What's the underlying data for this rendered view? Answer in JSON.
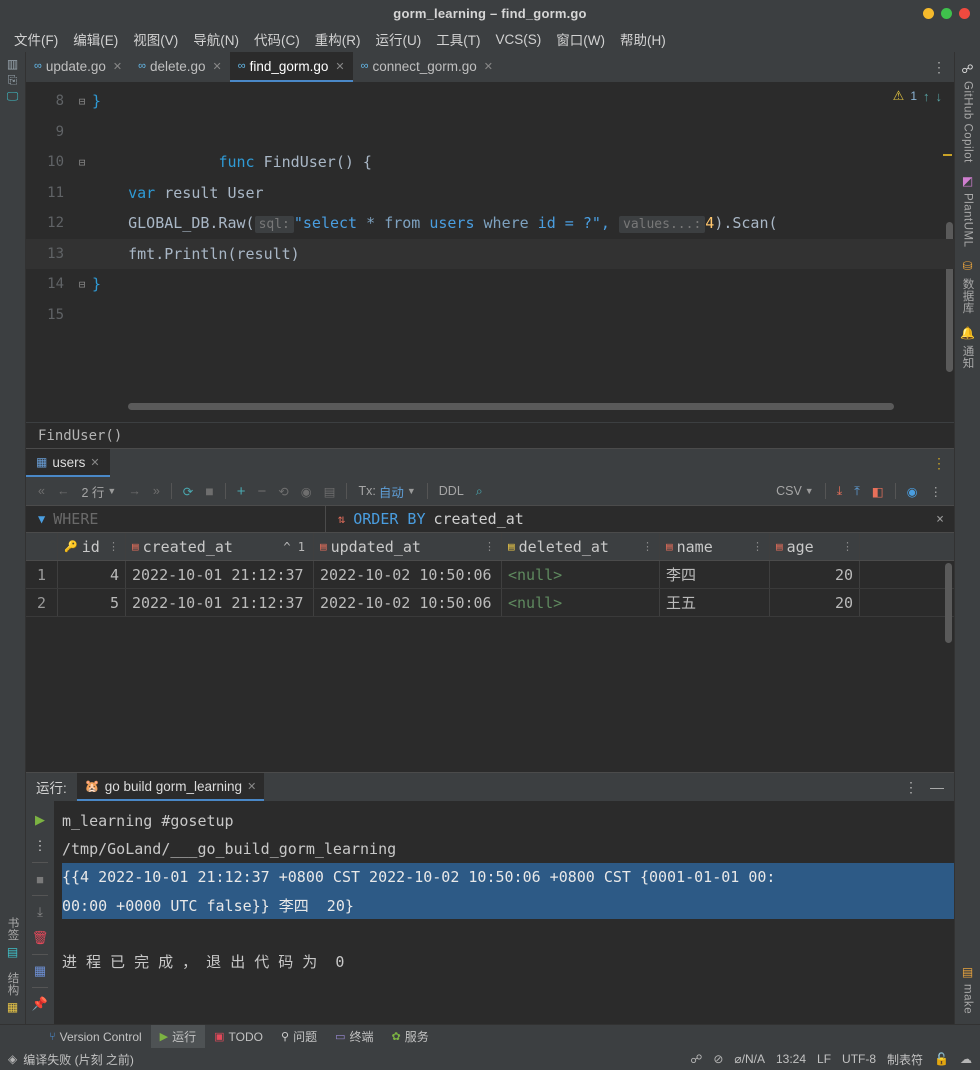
{
  "window": {
    "title": "gorm_learning – find_gorm.go",
    "controls": [
      "minimize",
      "maximize",
      "close"
    ]
  },
  "menubar": {
    "items": [
      {
        "label": "文件(F)",
        "mnemonic": "F"
      },
      {
        "label": "编辑(E)",
        "mnemonic": "E"
      },
      {
        "label": "视图(V)",
        "mnemonic": "V"
      },
      {
        "label": "导航(N)",
        "mnemonic": "N"
      },
      {
        "label": "代码(C)",
        "mnemonic": "C"
      },
      {
        "label": "重构(R)",
        "mnemonic": "R"
      },
      {
        "label": "运行(U)",
        "mnemonic": "U"
      },
      {
        "label": "工具(T)",
        "mnemonic": "T"
      },
      {
        "label": "VCS(S)",
        "mnemonic": "S"
      },
      {
        "label": "窗口(W)",
        "mnemonic": "W"
      },
      {
        "label": "帮助(H)",
        "mnemonic": "H"
      }
    ]
  },
  "left_rail": {
    "top_items": [
      "项目",
      "提交",
      "运行配置"
    ],
    "bottom_items": [
      {
        "label": "书签",
        "icon": "bookmark-icon"
      },
      {
        "label": "结构",
        "icon": "structure-icon"
      }
    ]
  },
  "right_rail": {
    "items": [
      {
        "label": "GitHub Copilot",
        "icon": "copilot-icon"
      },
      {
        "label": "PlantUML",
        "icon": "plantuml-icon"
      },
      {
        "label": "数据库",
        "icon": "database-icon"
      },
      {
        "label": "通知",
        "icon": "notifications-icon"
      }
    ],
    "bottom_items": [
      {
        "label": "make",
        "icon": "make-icon"
      }
    ]
  },
  "editor_tabs": {
    "tabs": [
      {
        "label": "update.go",
        "active": false
      },
      {
        "label": "delete.go",
        "active": false
      },
      {
        "label": "find_gorm.go",
        "active": true
      },
      {
        "label": "connect_gorm.go",
        "active": false
      }
    ]
  },
  "editor": {
    "warning_count": "1",
    "lines": [
      {
        "num": "8",
        "fold": "⊟",
        "current": false
      },
      {
        "num": "9",
        "fold": "",
        "current": false
      },
      {
        "num": "10",
        "fold": "⊟",
        "current": false
      },
      {
        "num": "11",
        "fold": "",
        "current": false
      },
      {
        "num": "12",
        "fold": "",
        "current": false
      },
      {
        "num": "13",
        "fold": "",
        "current": true
      },
      {
        "num": "14",
        "fold": "⊟",
        "current": false
      },
      {
        "num": "15",
        "fold": "",
        "current": false
      }
    ],
    "code": {
      "l8": "}",
      "l10_kw": "func",
      "l10_name": "FindUser",
      "l10_rest": "() {",
      "l11_kw": "var",
      "l11_rest": "result User",
      "l12_a": "GLOBAL_DB.Raw(",
      "l12_hint1": "sql:",
      "l12_str_open": "\"select ",
      "l12_star": "* ",
      "l12_from": "from",
      "l12_users": " users ",
      "l12_where": "where",
      "l12_tail": " id = ?\",",
      "l12_hint2": "values...:",
      "l12_num": "4",
      "l12_b": ").Scan(",
      "l13": "fmt.Println(result)",
      "l14": "}"
    },
    "breadcrumb": "FindUser()"
  },
  "db_panel": {
    "tab": {
      "label": "users",
      "icon": "table-icon"
    },
    "toolbar": {
      "first_page": "«",
      "prev_page": "←",
      "rows_label": "2 行",
      "next_page": "→",
      "last_page": "»",
      "reload": "reload-icon",
      "stop": "stop-icon",
      "add_row": "+",
      "delete_row": "−",
      "revert": "revert-icon",
      "view": "view-icon",
      "commit": "commit-icon",
      "tx_label": "Tx:",
      "tx_value": "自动",
      "ddl_label": "DDL",
      "search": "search-icon",
      "export_format": "CSV",
      "download": "download-icon",
      "upload": "upload-icon",
      "compare": "compare-icon",
      "eye": "eye-icon",
      "more": "more-icon"
    },
    "filters": {
      "where_placeholder": "WHERE",
      "order_by_keyword": "ORDER BY",
      "order_by_column": "created_at",
      "close": "×"
    },
    "columns": [
      {
        "name": "id",
        "icon": "primary-key-icon",
        "sort": ""
      },
      {
        "name": "created_at",
        "icon": "column-icon",
        "sort": "^ 1"
      },
      {
        "name": "updated_at",
        "icon": "column-icon",
        "sort": ""
      },
      {
        "name": "deleted_at",
        "icon": "nullable-column-icon",
        "sort": ""
      },
      {
        "name": "name",
        "icon": "column-icon",
        "sort": ""
      },
      {
        "name": "age",
        "icon": "column-icon",
        "sort": ""
      }
    ],
    "rows": [
      {
        "n": "1",
        "id": "4",
        "created_at": "2022-10-01 21:12:37",
        "updated_at": "2022-10-02 10:50:06",
        "deleted_at": "<null>",
        "name": "李四",
        "age": "20"
      },
      {
        "n": "2",
        "id": "5",
        "created_at": "2022-10-01 21:12:37",
        "updated_at": "2022-10-02 10:50:06",
        "deleted_at": "<null>",
        "name": "王五",
        "age": "20"
      }
    ]
  },
  "run_panel": {
    "label": "运行:",
    "config_name": "go build gorm_learning",
    "gutter_icons": [
      "rerun-icon",
      "more-icon",
      "stop-icon",
      "scroll-to-end-icon",
      "trash-icon",
      "layout-icon",
      "pin-icon"
    ],
    "console_lines": [
      {
        "text": "m_learning #gosetup",
        "selected": false
      },
      {
        "text": "/tmp/GoLand/___go_build_gorm_learning",
        "selected": false
      },
      {
        "text": "{{4 2022-10-01 21:12:37 +0800 CST 2022-10-02 10:50:06 +0800 CST {0001-01-01 00:",
        "selected": true
      },
      {
        "text": "00:00 +0000 UTC false}} 李四  20}",
        "selected": true
      },
      {
        "text": "",
        "selected": false
      },
      {
        "text": "进 程 已 完 成 ， 退 出 代 码 为  0",
        "selected": false
      }
    ]
  },
  "bottom_tabs": {
    "items": [
      {
        "label": "Version Control",
        "icon": "branch-icon",
        "active": false
      },
      {
        "label": "运行",
        "icon": "run-icon",
        "active": true
      },
      {
        "label": "TODO",
        "icon": "todo-icon",
        "active": false
      },
      {
        "label": "问题",
        "icon": "problems-icon",
        "active": false
      },
      {
        "label": "终端",
        "icon": "terminal-icon",
        "active": false
      },
      {
        "label": "服务",
        "icon": "services-icon",
        "active": false
      }
    ]
  },
  "status_bar": {
    "message": "编译失败 (片刻 之前)",
    "message_icon": "build-icon",
    "right_items": [
      {
        "label": "",
        "icon": "copilot-status-icon"
      },
      {
        "label": "",
        "icon": "no-access-icon"
      },
      {
        "label": "⌀/N/A",
        "icon": ""
      },
      {
        "label": "13:24",
        "icon": ""
      },
      {
        "label": "LF",
        "icon": ""
      },
      {
        "label": "UTF-8",
        "icon": ""
      },
      {
        "label": "制表符",
        "icon": ""
      },
      {
        "label": "",
        "icon": "lock-icon"
      },
      {
        "label": "",
        "icon": "cloud-icon"
      }
    ]
  }
}
